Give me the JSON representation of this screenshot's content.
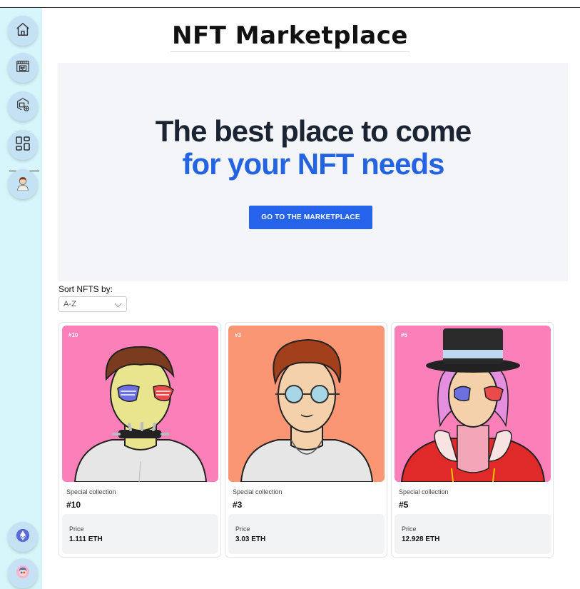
{
  "header": {
    "title": "NFT Marketplace"
  },
  "sidebar": {
    "items": [
      {
        "icon": "home-icon"
      },
      {
        "icon": "nft-store-icon"
      },
      {
        "icon": "nft-create-icon"
      },
      {
        "icon": "grid-icon"
      },
      {
        "icon": "avatar"
      }
    ],
    "bottom": [
      {
        "icon": "ethereum-icon"
      },
      {
        "icon": "user-avatar"
      }
    ]
  },
  "hero": {
    "line1": "The best place to come",
    "line2": "for your NFT needs",
    "cta": "GO TO THE MARKETPLACE",
    "background": "#f3f5f8",
    "accent": "#2464e1"
  },
  "sort": {
    "label": "Sort NFTS by:",
    "value": "A-Z"
  },
  "cards": [
    {
      "tag": "#10",
      "collection": "Special collection",
      "name": "#10",
      "price_label": "Price",
      "price": "1.111 ETH",
      "bg": "#fb7fb9"
    },
    {
      "tag": "#3",
      "collection": "Special collection",
      "name": "#3",
      "price_label": "Price",
      "price": "3.03 ETH",
      "bg": "#fa9674"
    },
    {
      "tag": "#5",
      "collection": "Special collection",
      "name": "#5",
      "price_label": "Price",
      "price": "12.928 ETH",
      "bg": "#fb7fb9"
    }
  ]
}
